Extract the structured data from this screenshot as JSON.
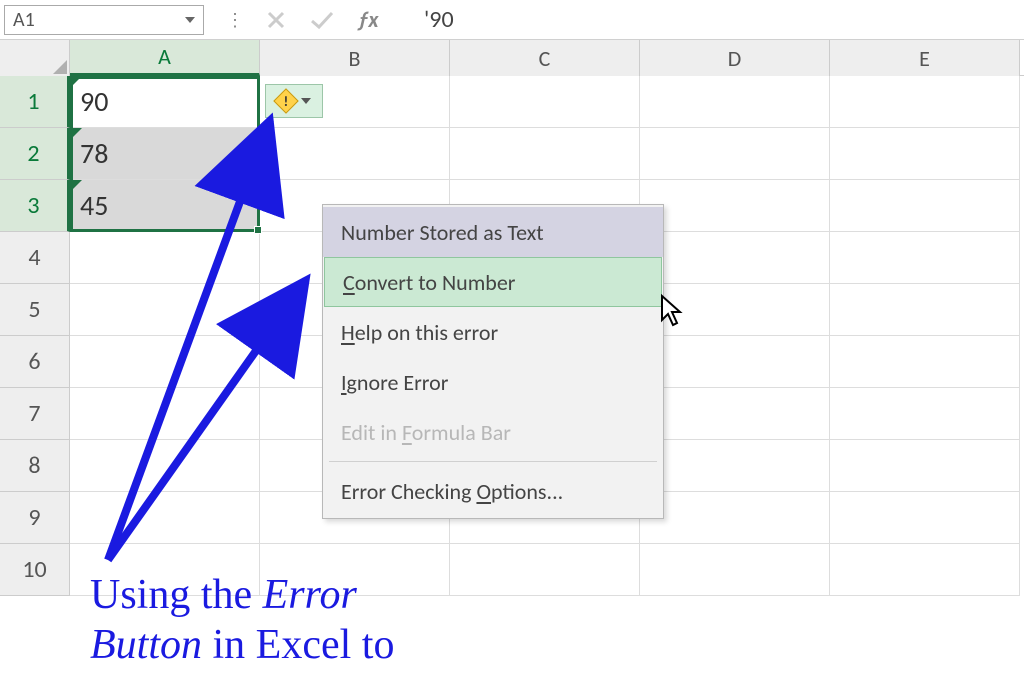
{
  "formula_bar": {
    "name_box": "A1",
    "formula_value": "'90"
  },
  "columns": [
    "A",
    "B",
    "C",
    "D",
    "E"
  ],
  "selected_column": "A",
  "rows": [
    1,
    2,
    3,
    4,
    5,
    6,
    7,
    8,
    9,
    10
  ],
  "selected_rows": [
    1,
    2,
    3
  ],
  "cells": {
    "A1": "90",
    "A2": "78",
    "A3": "45"
  },
  "error_menu": {
    "title": "Number Stored as Text",
    "items": [
      {
        "label_pre": "",
        "accel": "C",
        "label_post": "onvert to Number",
        "hover": true,
        "disabled": false
      },
      {
        "label_pre": "",
        "accel": "H",
        "label_post": "elp on this error",
        "hover": false,
        "disabled": false
      },
      {
        "label_pre": "",
        "accel": "I",
        "label_post": "gnore Error",
        "hover": false,
        "disabled": false
      },
      {
        "label_pre": "Edit in ",
        "accel": "F",
        "label_post": "ormula Bar",
        "hover": false,
        "disabled": true
      },
      {
        "label_pre": "Error Checking ",
        "accel": "O",
        "label_post": "ptions...",
        "hover": false,
        "disabled": false
      }
    ]
  },
  "annotation": {
    "line1_pre": "Using the ",
    "line1_em": "Error",
    "line2_em": "Button",
    "line2_post": " in Excel to"
  },
  "icons": {
    "warning": "!",
    "error_button": "error-indicator"
  }
}
